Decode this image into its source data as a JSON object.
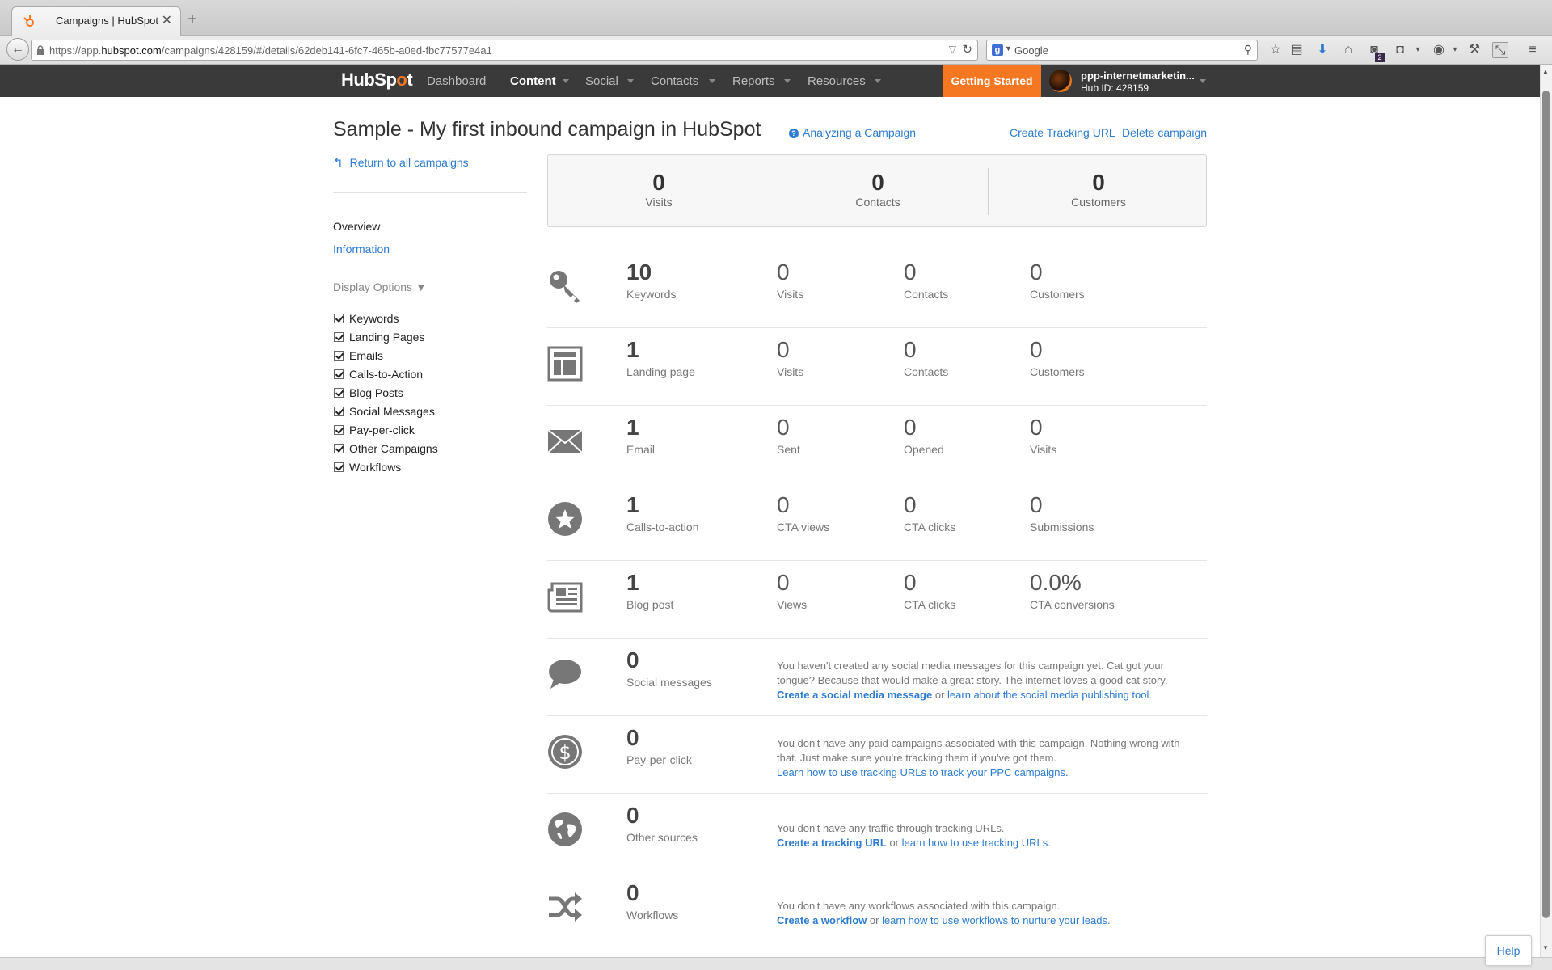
{
  "browser": {
    "tab_title": "Campaigns | HubSpot",
    "url_prefix": "https://app.",
    "url_domain": "hubspot.com",
    "url_path": "/campaigns/428159/#/details/62deb141-6fc7-465b-a0ed-fbc77577e4a1",
    "search_placeholder": "Google",
    "download_badge": "2"
  },
  "hs_nav": {
    "logo_text_a": "HubSp",
    "logo_text_b": "t",
    "menu": [
      "Dashboard",
      "Content",
      "Social",
      "Contacts",
      "Reports",
      "Resources"
    ],
    "active": "Content",
    "getting_started": "Getting Started",
    "account_name": "ppp-internetmarketin...",
    "hub_id": "Hub ID: 428159"
  },
  "page": {
    "title": "Sample - My first inbound campaign in HubSpot",
    "help_link": "Analyzing a Campaign",
    "create_tracking": "Create Tracking URL",
    "delete_campaign": "Delete campaign",
    "return_link": "Return to all campaigns"
  },
  "sidebar": {
    "overview": "Overview",
    "information": "Information",
    "display_options": "Display Options ▼",
    "options": [
      "Keywords",
      "Landing Pages",
      "Emails",
      "Calls-to-Action",
      "Blog Posts",
      "Social Messages",
      "Pay-per-click",
      "Other Campaigns",
      "Workflows"
    ]
  },
  "totals": [
    {
      "value": "0",
      "label": "Visits"
    },
    {
      "value": "0",
      "label": "Contacts"
    },
    {
      "value": "0",
      "label": "Customers"
    }
  ],
  "rows": [
    {
      "icon": "key-icon",
      "metrics": [
        {
          "value": "10",
          "label": "Keywords"
        },
        {
          "value": "0",
          "label": "Visits"
        },
        {
          "value": "0",
          "label": "Contacts"
        },
        {
          "value": "0",
          "label": "Customers"
        }
      ]
    },
    {
      "icon": "landing-page-icon",
      "metrics": [
        {
          "value": "1",
          "label": "Landing page"
        },
        {
          "value": "0",
          "label": "Visits"
        },
        {
          "value": "0",
          "label": "Contacts"
        },
        {
          "value": "0",
          "label": "Customers"
        }
      ]
    },
    {
      "icon": "envelope-icon",
      "metrics": [
        {
          "value": "1",
          "label": "Email"
        },
        {
          "value": "0",
          "label": "Sent"
        },
        {
          "value": "0",
          "label": "Opened"
        },
        {
          "value": "0",
          "label": "Visits"
        }
      ]
    },
    {
      "icon": "star-icon",
      "metrics": [
        {
          "value": "1",
          "label": "Calls-to-action"
        },
        {
          "value": "0",
          "label": "CTA views"
        },
        {
          "value": "0",
          "label": "CTA clicks"
        },
        {
          "value": "0",
          "label": "Submissions"
        }
      ]
    },
    {
      "icon": "newspaper-icon",
      "metrics": [
        {
          "value": "1",
          "label": "Blog post"
        },
        {
          "value": "0",
          "label": "Views"
        },
        {
          "value": "0",
          "label": "CTA clicks"
        },
        {
          "value": "0.0%",
          "label": "CTA conversions"
        }
      ]
    },
    {
      "icon": "speech-bubble-icon",
      "metrics": [
        {
          "value": "0",
          "label": "Social messages"
        }
      ],
      "message": {
        "text": "You haven't created any social media messages for this campaign yet. Cat got your tongue? Because that would make a great story. The internet loves a good cat story.",
        "link1": "Create a social media message",
        "sep": " or ",
        "link2": "learn about the social media publishing tool."
      }
    },
    {
      "icon": "dollar-icon",
      "metrics": [
        {
          "value": "0",
          "label": "Pay-per-click"
        }
      ],
      "message": {
        "text": "You don't have any paid campaigns associated with this campaign. Nothing wrong with that. Just make sure you're tracking them if you've got them.",
        "link1": "",
        "sep": "",
        "link2": "Learn how to use tracking URLs to track your PPC campaigns."
      }
    },
    {
      "icon": "globe-icon",
      "metrics": [
        {
          "value": "0",
          "label": "Other sources"
        }
      ],
      "message": {
        "text": "You don't have any traffic through tracking URLs.",
        "link1": "Create a tracking URL",
        "sep": " or ",
        "link2": "learn how to use tracking URLs."
      }
    },
    {
      "icon": "shuffle-icon",
      "metrics": [
        {
          "value": "0",
          "label": "Workflows"
        }
      ],
      "message": {
        "text": "You don't have any workflows associated with this campaign.",
        "link1": "Create a workflow",
        "sep": " or ",
        "link2": "learn how to use workflows to nurture your leads."
      }
    }
  ],
  "help_button": "Help",
  "colors": {
    "accent": "#f57722",
    "link": "#2b7bd1",
    "nav_bg": "#3a3a3a"
  }
}
